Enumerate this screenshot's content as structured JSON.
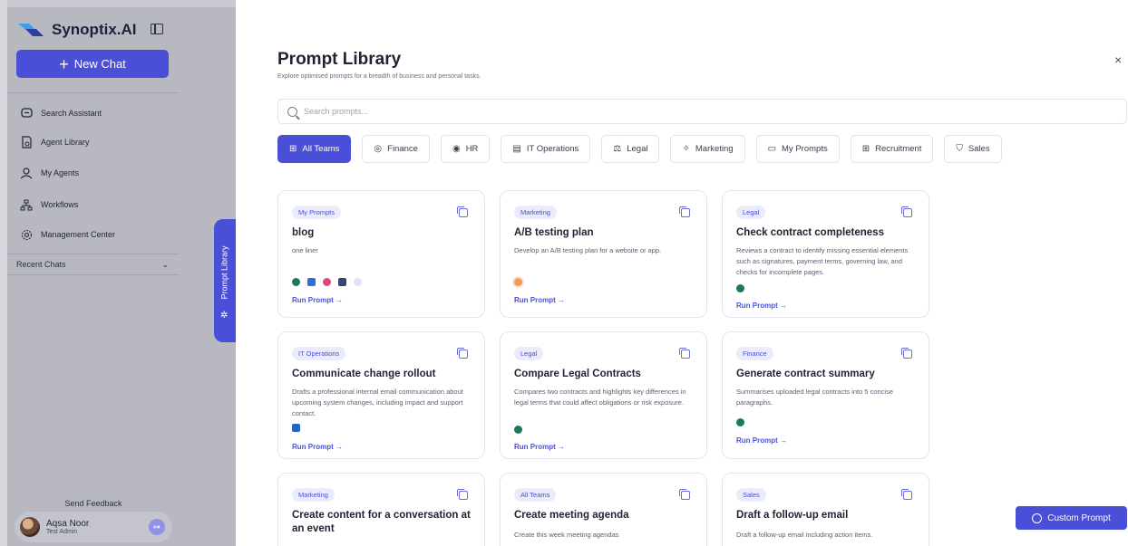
{
  "app": {
    "brand_name": "Synoptix.AI",
    "new_chat": "New Chat",
    "accent": "#4a4fd8"
  },
  "sidebar": {
    "items": [
      {
        "label": "Search Assistant",
        "icon": "chat-bubble-icon"
      },
      {
        "label": "Agent Library",
        "icon": "agent-library-icon"
      },
      {
        "label": "My Agents",
        "icon": "agents-icon"
      },
      {
        "label": "Workflows",
        "icon": "workflows-icon"
      },
      {
        "label": "Management Center",
        "icon": "gear-icon"
      }
    ],
    "recent_chats": "Recent Chats",
    "send_feedback": "Send Feedback",
    "user": {
      "name": "Aqsa Noor",
      "role": "Test Admin"
    }
  },
  "side_tab": {
    "label": "Prompt Library"
  },
  "modal": {
    "title": "Prompt Library",
    "subtitle": "Explore optimised prompts for a breadth of business and personal tasks.",
    "close": "×",
    "search_placeholder": "Search prompts...",
    "filters": [
      {
        "label": "All Teams",
        "icon": "⊞"
      },
      {
        "label": "Finance",
        "icon": "◎"
      },
      {
        "label": "HR",
        "icon": "◉"
      },
      {
        "label": "IT Operations",
        "icon": "▤"
      },
      {
        "label": "Legal",
        "icon": "⚖"
      },
      {
        "label": "Marketing",
        "icon": "✧"
      },
      {
        "label": "My Prompts",
        "icon": "▭"
      },
      {
        "label": "Recruitment",
        "icon": "⊞"
      },
      {
        "label": "Sales",
        "icon": "⛉"
      }
    ],
    "cards": [
      {
        "tag": "My Prompts",
        "title": "blog",
        "desc": "one liner",
        "run": "Run Prompt →"
      },
      {
        "tag": "Marketing",
        "title": "A/B testing plan",
        "desc": "Develop an A/B testing plan for a website or app.",
        "run": "Run Prompt →"
      },
      {
        "tag": "Legal",
        "title": "Check contract completeness",
        "desc": "Reviews a contract to identify missing essential elements such as signatures, payment terms, governing law, and checks for incomplete pages.",
        "run": "Run Prompt →"
      },
      {
        "tag": "IT Operations",
        "title": "Communicate change rollout",
        "desc": "Drafts a professional internal email communication about upcoming system changes, including impact and support contact.",
        "run": "Run Prompt →"
      },
      {
        "tag": "Legal",
        "title": "Compare Legal Contracts",
        "desc": "Compares two contracts and highlights key differences in legal terms that could affect obligations or risk exposure.",
        "run": "Run Prompt →"
      },
      {
        "tag": "Finance",
        "title": "Generate contract summary",
        "desc": "Summarises uploaded legal contracts into 5 concise paragraphs.",
        "run": "Run Prompt →"
      },
      {
        "tag": "Marketing",
        "title": "Create content for a conversation at an event",
        "desc": "",
        "run": ""
      },
      {
        "tag": "All Teams",
        "title": "Create meeting agenda",
        "desc": "Create this week meeting agendas",
        "run": ""
      },
      {
        "tag": "Sales",
        "title": "Draft a follow-up email",
        "desc": "Draft a follow-up email including action items.",
        "run": ""
      }
    ],
    "custom_prompt": "Custom Prompt"
  }
}
